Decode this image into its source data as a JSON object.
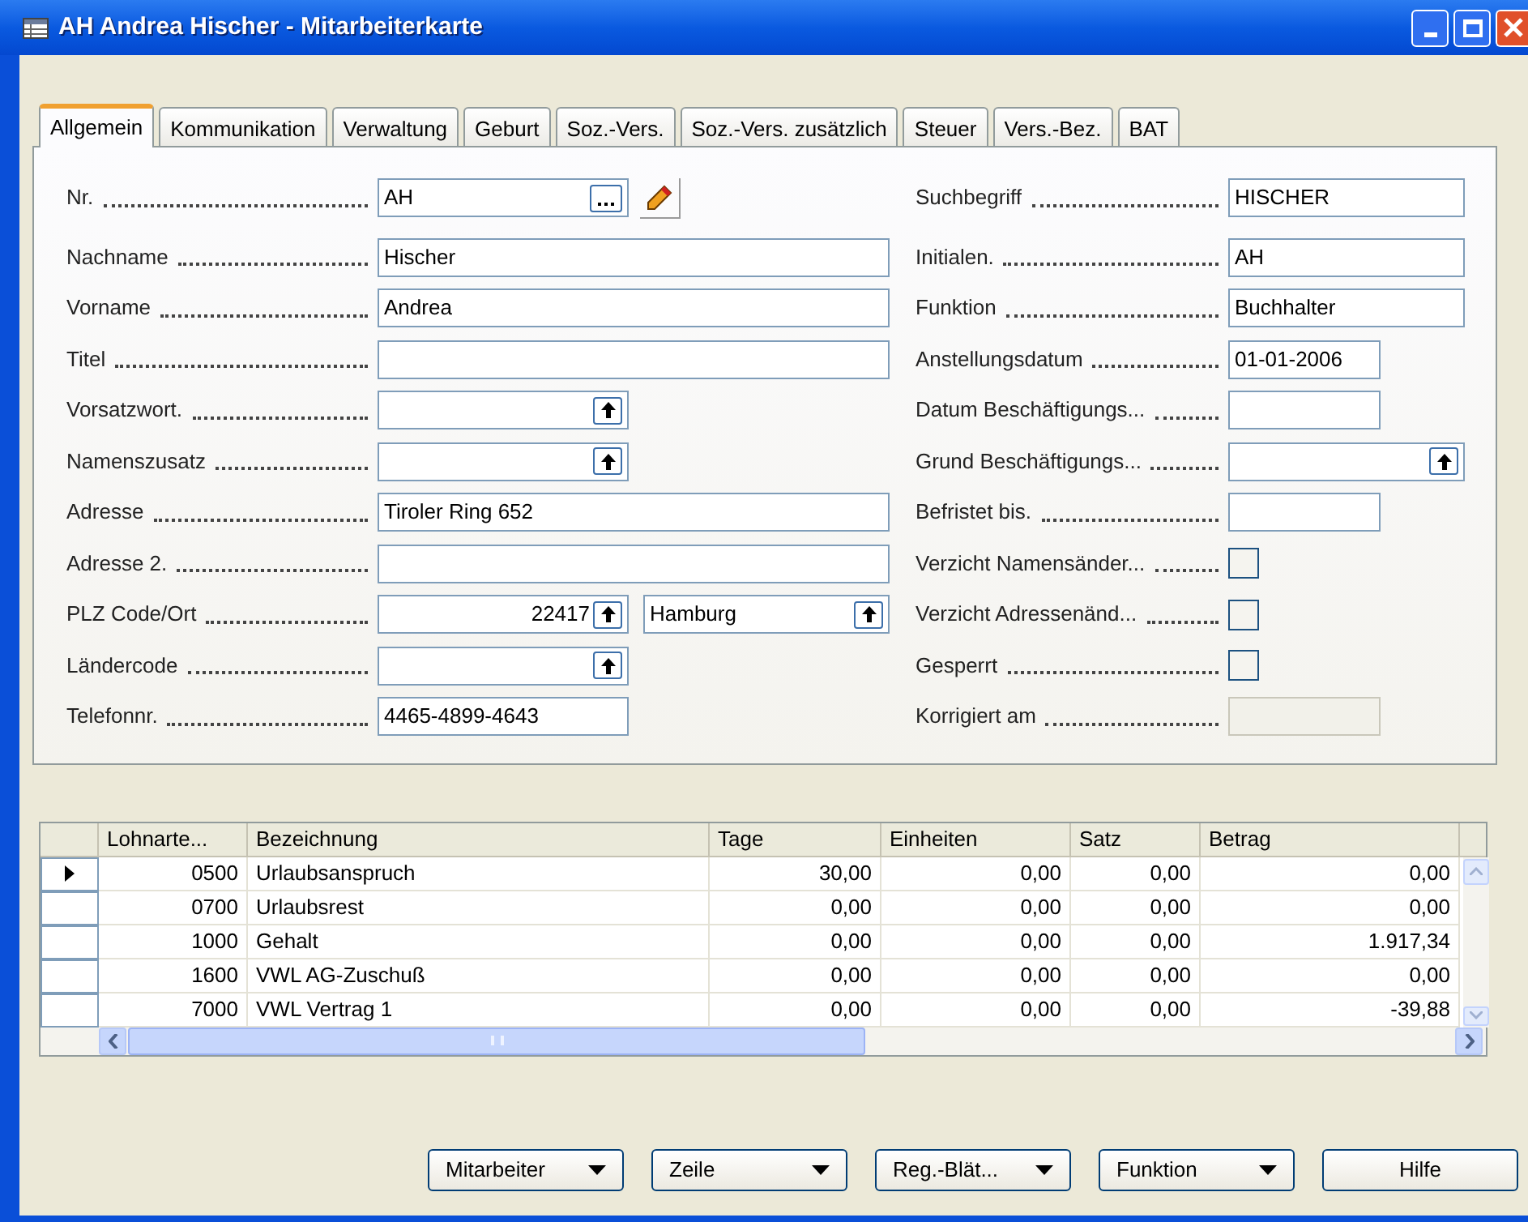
{
  "window": {
    "title": "AH Andrea Hischer - Mitarbeiterkarte"
  },
  "tabs": [
    {
      "label": "Allgemein",
      "selected": true
    },
    {
      "label": "Kommunikation",
      "selected": false
    },
    {
      "label": "Verwaltung",
      "selected": false
    },
    {
      "label": "Geburt",
      "selected": false
    },
    {
      "label": "Soz.-Vers.",
      "selected": false
    },
    {
      "label": "Soz.-Vers. zusätzlich",
      "selected": false
    },
    {
      "label": "Steuer",
      "selected": false
    },
    {
      "label": "Vers.-Bez.",
      "selected": false
    },
    {
      "label": "BAT",
      "selected": false
    }
  ],
  "left_fields": [
    {
      "label": "Nr.",
      "kind": "assist",
      "value": "AH"
    },
    {
      "label": "Nachname",
      "kind": "text",
      "value": "Hischer"
    },
    {
      "label": "Vorname",
      "kind": "text",
      "value": "Andrea"
    },
    {
      "label": "Titel",
      "kind": "text"
    },
    {
      "label": "Vorsatzwort.",
      "kind": "lookup"
    },
    {
      "label": "Namenszusatz",
      "kind": "lookup"
    },
    {
      "label": "Adresse",
      "kind": "text",
      "value": "Tiroler Ring 652"
    },
    {
      "label": "Adresse 2.",
      "kind": "text"
    },
    {
      "label": "PLZ Code/Ort",
      "kind": "place",
      "value": "22417",
      "city": "Hamburg"
    },
    {
      "label": "Ländercode",
      "kind": "lookup"
    },
    {
      "label": "Telefonnr.",
      "kind": "short",
      "value": "4465-4899-4643"
    }
  ],
  "right_fields": [
    {
      "label": "Suchbegriff",
      "kind": "text",
      "value": "HISCHER"
    },
    {
      "label": "Initialen.",
      "kind": "text",
      "value": "AH"
    },
    {
      "label": "Funktion",
      "kind": "text",
      "value": "Buchhalter"
    },
    {
      "label": "Anstellungsdatum",
      "kind": "short",
      "value": "01-01-2006"
    },
    {
      "label": "Datum Beschäftigungs...",
      "kind": "short"
    },
    {
      "label": "Grund Beschäftigungs...",
      "kind": "longlookup"
    },
    {
      "label": "Befristet bis.",
      "kind": "short"
    },
    {
      "label": "Verzicht Namensänder...",
      "kind": "checkbox",
      "checked": false
    },
    {
      "label": "Verzicht Adressenänd...",
      "kind": "checkbox",
      "checked": false
    },
    {
      "label": "Gesperrt",
      "kind": "checkbox",
      "checked": false
    },
    {
      "label": "Korrigiert am",
      "kind": "short",
      "disabled": true
    }
  ],
  "table": {
    "columns": [
      "Lohnarte...",
      "Bezeichnung",
      "Tage",
      "Einheiten",
      "Satz",
      "Betrag"
    ],
    "rows": [
      {
        "selected": true,
        "cells": [
          "0500",
          "Urlaubsanspruch",
          "30,00",
          "0,00",
          "0,00",
          "0,00"
        ]
      },
      {
        "selected": false,
        "cells": [
          "0700",
          "Urlaubsrest",
          "0,00",
          "0,00",
          "0,00",
          "0,00"
        ]
      },
      {
        "selected": false,
        "cells": [
          "1000",
          "Gehalt",
          "0,00",
          "0,00",
          "0,00",
          "1.917,34"
        ]
      },
      {
        "selected": false,
        "cells": [
          "1600",
          "VWL AG-Zuschuß",
          "0,00",
          "0,00",
          "0,00",
          "0,00"
        ]
      },
      {
        "selected": false,
        "cells": [
          "7000",
          "VWL Vertrag 1",
          "0,00",
          "0,00",
          "0,00",
          "-39,88"
        ]
      }
    ]
  },
  "buttons": [
    {
      "label": "Mitarbeiter",
      "kind": "menu"
    },
    {
      "label": "Zeile",
      "kind": "menu"
    },
    {
      "label": "Reg.-Blät...",
      "kind": "menu"
    },
    {
      "label": "Funktion",
      "kind": "menu"
    },
    {
      "label": "Hilfe",
      "kind": "plain"
    }
  ]
}
